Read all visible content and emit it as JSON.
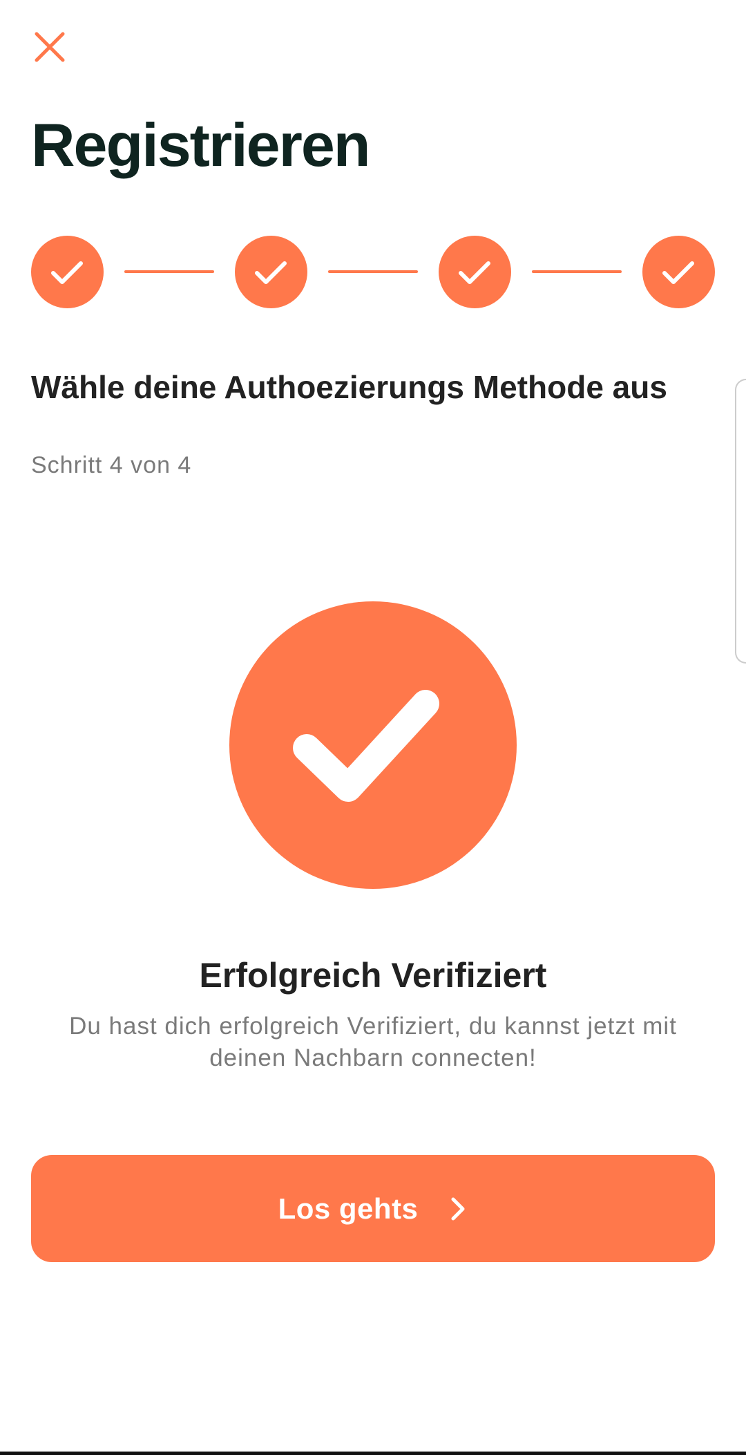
{
  "header": {
    "close_icon": "close-icon",
    "title": "Registrieren"
  },
  "stepper": {
    "total_steps": 4,
    "completed_steps": 4,
    "step_icon": "check-icon"
  },
  "section": {
    "title": "Wähle deine Authoezierungs Methode aus",
    "step_counter": "Schritt 4 von 4"
  },
  "success": {
    "icon": "check-circle-icon",
    "title": "Erfolgreich Verifiziert",
    "description": "Du hast dich erfolgreich Verifiziert, du kannst jetzt mit deinen Nachbarn connecten!"
  },
  "primary_button": {
    "label": "Los gehts",
    "icon": "chevron-right-icon"
  },
  "colors": {
    "accent": "#ff784b",
    "title": "#0f2420",
    "text": "#222222",
    "muted": "#7a7a7a",
    "background": "#ffffff"
  }
}
